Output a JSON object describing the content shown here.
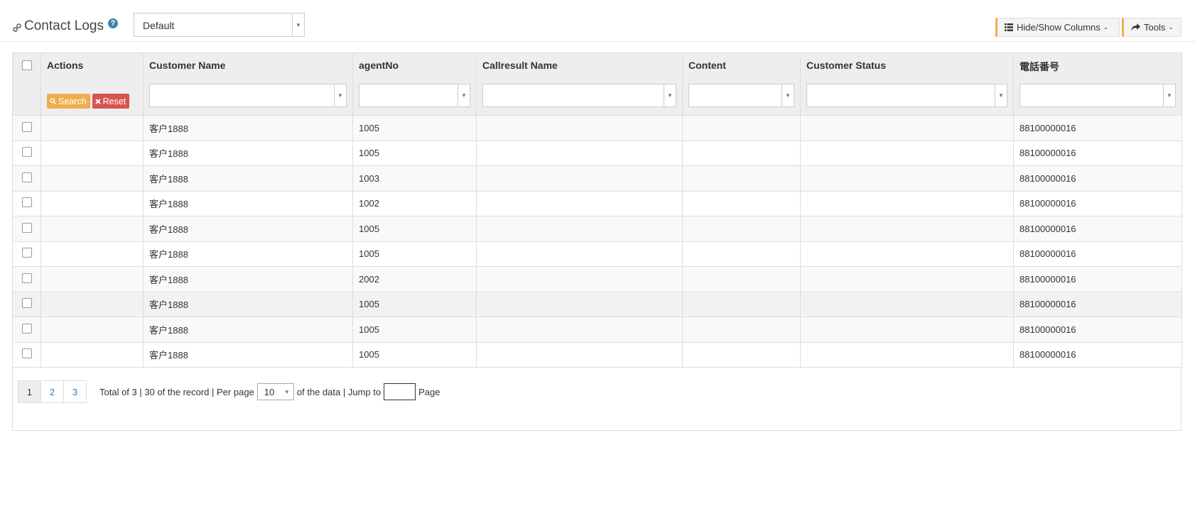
{
  "header": {
    "title": "Contact Logs",
    "help": "?",
    "view_select": "Default",
    "hide_show_label": "Hide/Show Columns",
    "tools_label": "Tools"
  },
  "table": {
    "columns": [
      "Actions",
      "Customer Name",
      "agentNo",
      "Callresult Name",
      "Content",
      "Customer Status",
      "電話番号"
    ],
    "search_label": "Search",
    "reset_label": "Reset",
    "rows": [
      {
        "customer": "客户1888",
        "agent": "1005",
        "callresult": "",
        "content": "",
        "status": "",
        "phone": "88100000016"
      },
      {
        "customer": "客户1888",
        "agent": "1005",
        "callresult": "",
        "content": "",
        "status": "",
        "phone": "88100000016"
      },
      {
        "customer": "客户1888",
        "agent": "1003",
        "callresult": "",
        "content": "",
        "status": "",
        "phone": "88100000016"
      },
      {
        "customer": "客户1888",
        "agent": "1002",
        "callresult": "",
        "content": "",
        "status": "",
        "phone": "88100000016"
      },
      {
        "customer": "客户1888",
        "agent": "1005",
        "callresult": "",
        "content": "",
        "status": "",
        "phone": "88100000016"
      },
      {
        "customer": "客户1888",
        "agent": "1005",
        "callresult": "",
        "content": "",
        "status": "",
        "phone": "88100000016"
      },
      {
        "customer": "客户1888",
        "agent": "2002",
        "callresult": "",
        "content": "",
        "status": "",
        "phone": "88100000016"
      },
      {
        "customer": "客户1888",
        "agent": "1005",
        "callresult": "",
        "content": "",
        "status": "",
        "phone": "88100000016"
      },
      {
        "customer": "客户1888",
        "agent": "1005",
        "callresult": "",
        "content": "",
        "status": "",
        "phone": "88100000016"
      },
      {
        "customer": "客户1888",
        "agent": "1005",
        "callresult": "",
        "content": "",
        "status": "",
        "phone": "88100000016"
      }
    ]
  },
  "pager": {
    "pages": [
      "1",
      "2",
      "3"
    ],
    "current": "1",
    "info_text": "Total of 3 | 30 of the record | Per page",
    "per_page": "10",
    "of_data_text": "of the data | Jump to",
    "page_word": "Page"
  },
  "colors": {
    "accent": "#f0ad4e",
    "reset": "#d9534f",
    "link": "#337ab7",
    "help": "#3a87ad"
  }
}
